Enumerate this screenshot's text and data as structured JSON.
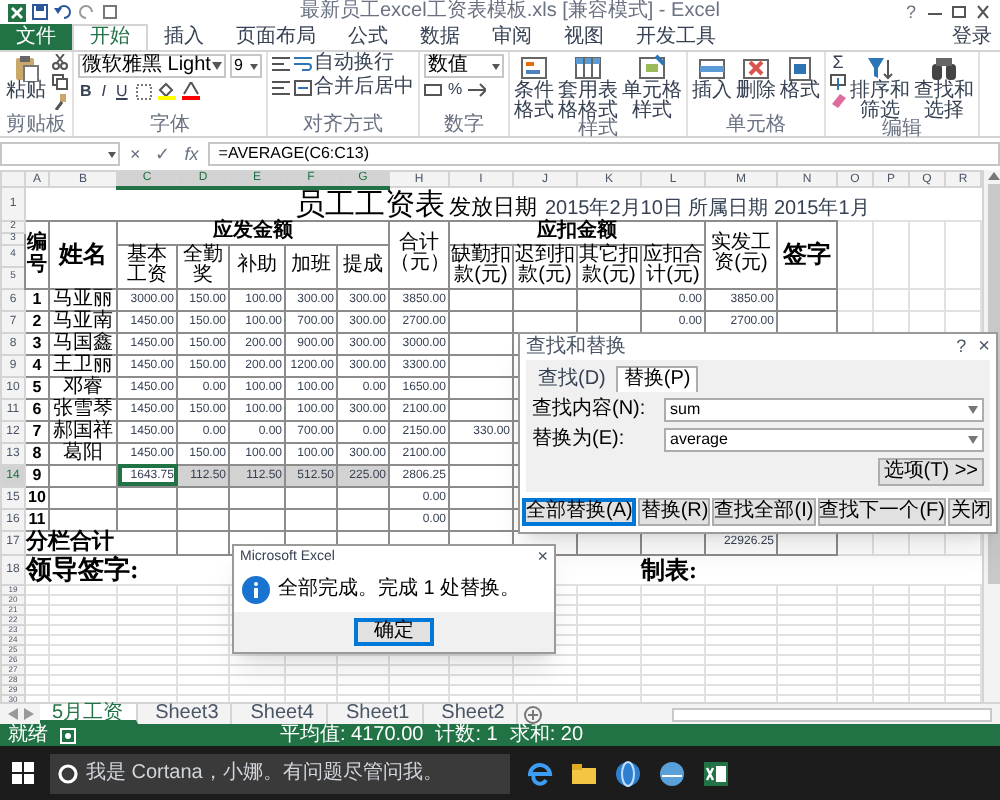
{
  "window": {
    "title": "最新员工excel工资表模板.xls [兼容模式] - Excel",
    "help": "?"
  },
  "ribbon_tabs": [
    {
      "label": "文件",
      "kind": "file",
      "selected": false
    },
    {
      "label": "开始",
      "kind": "tab",
      "selected": true
    },
    {
      "label": "插入",
      "kind": "tab",
      "selected": false
    },
    {
      "label": "页面布局",
      "kind": "tab",
      "selected": false
    },
    {
      "label": "公式",
      "kind": "tab",
      "selected": false
    },
    {
      "label": "数据",
      "kind": "tab",
      "selected": false
    },
    {
      "label": "审阅",
      "kind": "tab",
      "selected": false
    },
    {
      "label": "视图",
      "kind": "tab",
      "selected": false
    },
    {
      "label": "开发工具",
      "kind": "tab",
      "selected": false
    }
  ],
  "account": "登录",
  "ribbon_groups": [
    {
      "kind": "clipboard",
      "label": "剪贴板",
      "buttons": [
        "粘贴"
      ]
    },
    {
      "kind": "font",
      "label": "字体",
      "font": "微软雅黑 Light",
      "size": "9",
      "styles": [
        "B",
        "I",
        "U"
      ]
    },
    {
      "kind": "alignment",
      "label": "对齐方式",
      "buttons": [
        "自动换行",
        "合并后居中"
      ]
    },
    {
      "kind": "number",
      "label": "数字",
      "format": "数值",
      "symbols": [
        "%"
      ]
    },
    {
      "kind": "styles",
      "label": "样式",
      "buttons": [
        "条件格式",
        "套用表格格式",
        "单元格样式"
      ]
    },
    {
      "kind": "cells",
      "label": "单元格",
      "buttons": [
        "插入",
        "删除",
        "格式"
      ]
    },
    {
      "kind": "editing",
      "label": "编辑",
      "symbols": [
        "Σ"
      ],
      "buttons": [
        "排序和筛选",
        "查找和选择"
      ]
    }
  ],
  "formula_bar": {
    "buttons": [
      "×",
      "✓",
      "fx"
    ],
    "formula": "=AVERAGE(C6:C13)"
  },
  "sheet": {
    "columns": [
      "A",
      "B",
      "C",
      "D",
      "E",
      "F",
      "G",
      "H",
      "I",
      "J",
      "K",
      "L",
      "M",
      "N",
      "O",
      "P",
      "Q",
      "R"
    ],
    "title_row": {
      "row": "1",
      "title": "员工工资表",
      "date_label": "发放日期",
      "date_text": "2015年2月10日 所属日期 2015年1月"
    },
    "header": {
      "rows": [
        "2",
        "3",
        "4",
        "5"
      ],
      "number": "编号",
      "name": "姓名",
      "income": {
        "label": "应发金额",
        "columns": [
          "基本工资",
          "全勤奖",
          "补助",
          "加班",
          "提成"
        ]
      },
      "total": "合计（元）",
      "deductions": {
        "label": "应扣金额",
        "columns": [
          "缺勤扣款(元)",
          "迟到扣款(元)",
          "其它扣款(元)",
          "应扣合计(元)"
        ]
      },
      "net_pay": "实发工资(元)",
      "signature": "签字"
    },
    "rows": [
      {
        "row": "6",
        "no": "1",
        "name": "马亚丽",
        "selected": false,
        "cells": {
          "C": "3000.00",
          "D": "150.00",
          "E": "100.00",
          "F": "300.00",
          "G": "300.00",
          "H": "3850.00",
          "L": "0.00",
          "M": "3850.00"
        }
      },
      {
        "row": "7",
        "no": "2",
        "name": "马亚南",
        "selected": false,
        "cells": {
          "C": "1450.00",
          "D": "150.00",
          "E": "100.00",
          "F": "700.00",
          "G": "300.00",
          "H": "2700.00",
          "L": "0.00",
          "M": "2700.00"
        }
      },
      {
        "row": "8",
        "no": "3",
        "name": "马国鑫",
        "selected": false,
        "cells": {
          "C": "1450.00",
          "D": "150.00",
          "E": "200.00",
          "F": "900.00",
          "G": "300.00",
          "H": "3000.00"
        }
      },
      {
        "row": "9",
        "no": "4",
        "name": "王卫丽",
        "selected": false,
        "cells": {
          "C": "1450.00",
          "D": "150.00",
          "E": "200.00",
          "F": "1200.00",
          "G": "300.00",
          "H": "3300.00"
        }
      },
      {
        "row": "10",
        "no": "5",
        "name": "邓睿",
        "selected": false,
        "cells": {
          "C": "1450.00",
          "D": "0.00",
          "E": "100.00",
          "F": "100.00",
          "G": "0.00",
          "H": "1650.00"
        }
      },
      {
        "row": "11",
        "no": "6",
        "name": "张雪琴",
        "selected": false,
        "cells": {
          "C": "1450.00",
          "D": "150.00",
          "E": "100.00",
          "F": "100.00",
          "G": "300.00",
          "H": "2100.00"
        }
      },
      {
        "row": "12",
        "no": "7",
        "name": "郝国祥",
        "selected": false,
        "cells": {
          "C": "1450.00",
          "D": "0.00",
          "E": "0.00",
          "F": "700.00",
          "G": "0.00",
          "H": "2150.00",
          "I": "330.00"
        }
      },
      {
        "row": "13",
        "no": "8",
        "name": "葛阳",
        "selected": false,
        "cells": {
          "C": "1450.00",
          "D": "150.00",
          "E": "100.00",
          "F": "100.00",
          "G": "300.00",
          "H": "2100.00"
        }
      },
      {
        "row": "14",
        "no": "9",
        "selected": true,
        "cells": {
          "C": "1643.75",
          "D": "112.50",
          "E": "112.50",
          "F": "512.50",
          "G": "225.00",
          "H": "2806.25"
        }
      },
      {
        "row": "15",
        "no": "10",
        "selected": false,
        "cells": {
          "H": "0.00"
        }
      },
      {
        "row": "16",
        "no": "11",
        "selected": false,
        "cells": {
          "H": "0.00"
        }
      }
    ],
    "subtotal_row": {
      "row": "17",
      "label": "分栏合计",
      "cells": {
        "M": "22926.25"
      }
    },
    "sign_row": {
      "row": "18",
      "leader": "领导签字:",
      "maker": "制表:"
    },
    "empty_rows": [
      "19",
      "20",
      "21",
      "22",
      "23",
      "24",
      "25",
      "26",
      "27",
      "28",
      "29",
      "30"
    ]
  },
  "sheet_tabs": [
    {
      "label": "5月工资",
      "selected": true
    },
    {
      "label": "Sheet3",
      "selected": false
    },
    {
      "label": "Sheet4",
      "selected": false
    },
    {
      "label": "Sheet1",
      "selected": false
    },
    {
      "label": "Sheet2",
      "selected": false
    }
  ],
  "status_bar": {
    "mode": "就绪",
    "stats": [
      "平均值: 4170.00",
      "计数: 1",
      "求和: 20"
    ]
  },
  "taskbar": {
    "search_placeholder": "我是 Cortana，小娜。有问题尽管问我。"
  },
  "find_replace_dialog": {
    "title": "查找和替换",
    "help": "?",
    "close": "×",
    "tabs": [
      {
        "label": "查找(D)",
        "selected": false
      },
      {
        "label": "替换(P)",
        "selected": true
      }
    ],
    "fields": [
      {
        "label": "查找内容(N):",
        "value": "sum"
      },
      {
        "label": "替换为(E):",
        "value": "average"
      }
    ],
    "options_button": "选项(T) >>",
    "buttons": [
      {
        "label": "全部替换(A)",
        "default": true
      },
      {
        "label": "替换(R)",
        "default": false
      },
      {
        "label": "查找全部(I)",
        "default": false
      },
      {
        "label": "查找下一个(F)",
        "default": false
      },
      {
        "label": "关闭",
        "default": false
      }
    ]
  },
  "message_box": {
    "title": "Microsoft Excel",
    "close": "×",
    "message": "全部完成。完成 1 处替换。",
    "button": "确定"
  }
}
